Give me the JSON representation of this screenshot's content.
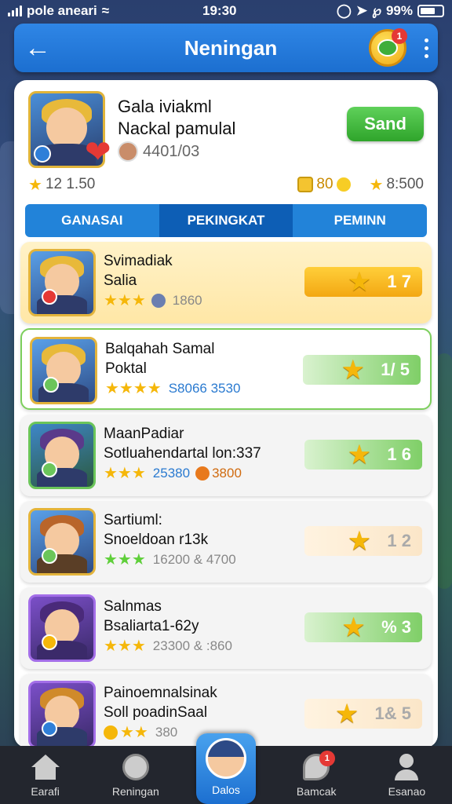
{
  "status_bar": {
    "carrier": "pole aneari",
    "time": "19:30",
    "battery": "99%"
  },
  "header": {
    "title": "Neningan",
    "chat_badge": "1"
  },
  "profile": {
    "name_line1": "Gala iviakml",
    "name_line2": "Nackal pamulal",
    "mini_value": "4401/03",
    "send_label": "Sand",
    "stat_left": "12 1.50",
    "stat_coins": "80",
    "stat_right": "8:500"
  },
  "tabs": [
    {
      "label": "GANASAI"
    },
    {
      "label": "PEKINGKAT"
    },
    {
      "label": "PEMINN"
    }
  ],
  "rows": [
    {
      "name1": "Svimadiak",
      "name2": "Salia",
      "sub": "1860",
      "score": "1 7"
    },
    {
      "name1": "Balqahah Samal",
      "name2": "Poktal",
      "sub": "S8066 3530",
      "score": "1/ 5"
    },
    {
      "name1": "MaanPadiar",
      "name2": "Sotluahendartal lon:337",
      "sub": "25380",
      "sub2": "3800",
      "score": "1 6"
    },
    {
      "name1": "Sartiuml:",
      "name2": "Snoeldoan r13k",
      "sub": "16200 & 4700",
      "score": "1 2"
    },
    {
      "name1": "Salnmas",
      "name2": "Bsaliarta1-62y",
      "sub": "23300 & :860",
      "score": "% 3"
    },
    {
      "name1": "Painoemnalsinak",
      "name2": "Soll poadinSaal",
      "sub": "380",
      "score": "1& 5"
    }
  ],
  "nav": {
    "items": [
      {
        "label": "Earafi"
      },
      {
        "label": "Reningan"
      },
      {
        "label": "Dalos"
      },
      {
        "label": "Bamcak"
      },
      {
        "label": "Esanao"
      }
    ],
    "badge": "1"
  }
}
